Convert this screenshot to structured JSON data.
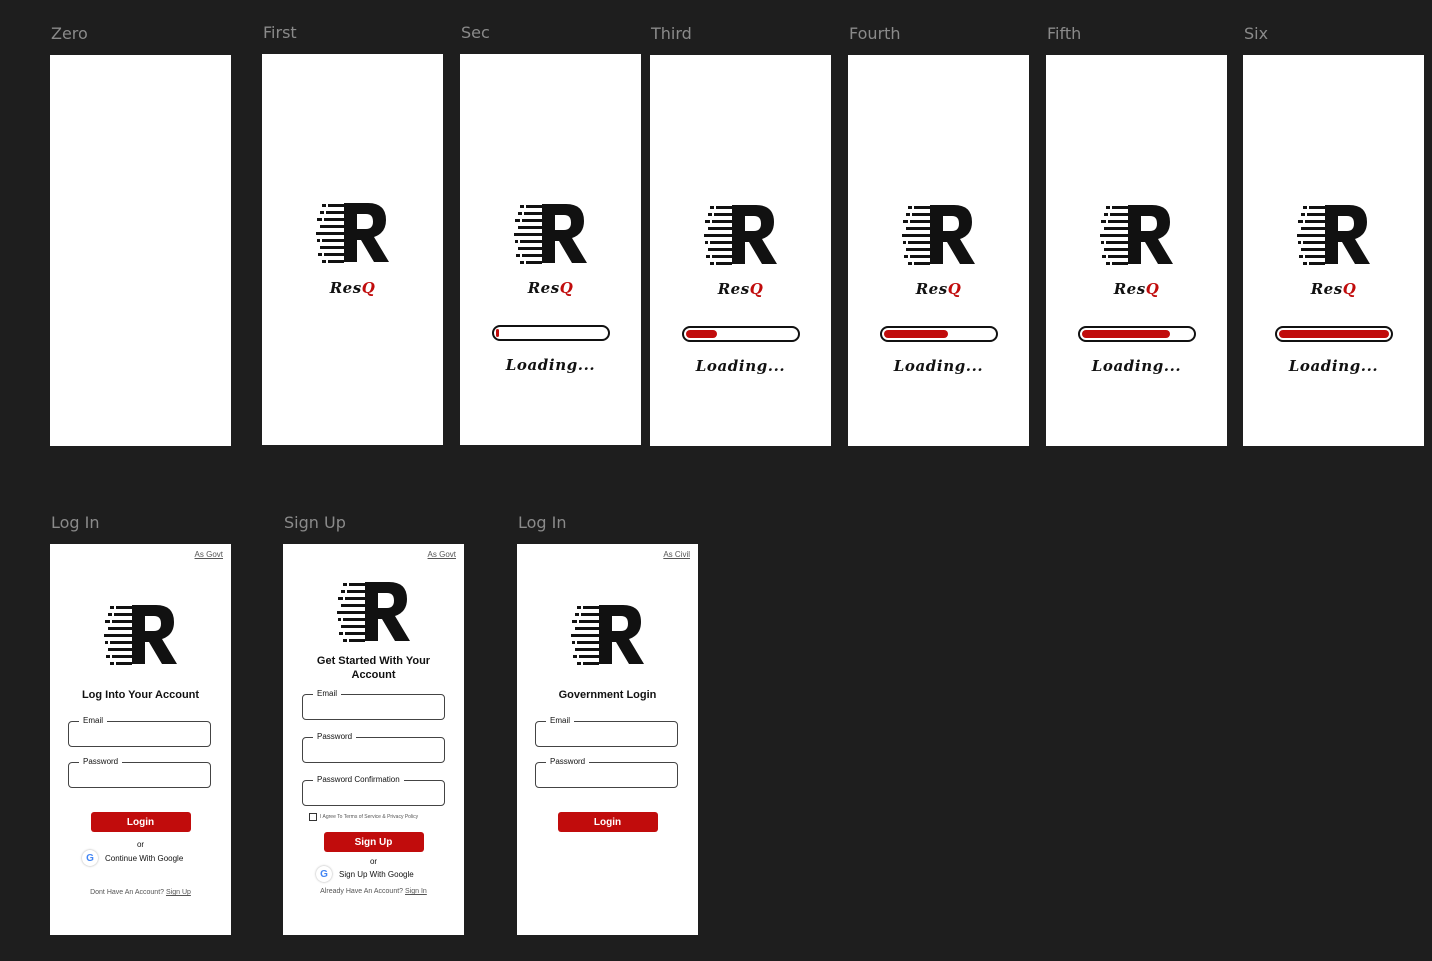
{
  "splash_frames": [
    {
      "label": "Zero"
    },
    {
      "label": "First",
      "brand": "Res",
      "brand_q": "Q"
    },
    {
      "label": "Sec",
      "brand": "Res",
      "brand_q": "Q",
      "loading": "Loading...",
      "progress": 0.03
    },
    {
      "label": "Third",
      "brand": "Res",
      "brand_q": "Q",
      "loading": "Loading...",
      "progress": 0.28
    },
    {
      "label": "Fourth",
      "brand": "Res",
      "brand_q": "Q",
      "loading": "Loading...",
      "progress": 0.58
    },
    {
      "label": "Fifth",
      "brand": "Res",
      "brand_q": "Q",
      "loading": "Loading...",
      "progress": 0.8
    },
    {
      "label": "Six",
      "brand": "Res",
      "brand_q": "Q",
      "loading": "Loading...",
      "progress": 1.0
    }
  ],
  "login": {
    "label": "Log In",
    "top_link": "As Govt",
    "heading": "Log Into Your Account",
    "email_label": "Email",
    "password_label": "Password",
    "login_button": "Login",
    "or": "or",
    "google_label": "Continue With Google",
    "bottom_text": "Dont Have An Account?",
    "bottom_link": "Sign Up"
  },
  "signup": {
    "label": "Sign Up",
    "top_link": "As Govt",
    "heading_line1": "Get Started With Your",
    "heading_line2": "Account",
    "email_label": "Email",
    "password_label": "Password",
    "confirm_label": "Password Confirmation",
    "terms": "I Agree To Terms of Service & Privacy Policy",
    "signup_button": "Sign Up",
    "or": "or",
    "google_label": "Sign Up With Google",
    "bottom_text": "Already Have An Account?",
    "bottom_link": "Sign In"
  },
  "gov_login": {
    "label": "Log In",
    "top_link": "As Civil",
    "heading": "Government Login",
    "email_label": "Email",
    "password_label": "Password",
    "login_button": "Login"
  },
  "colors": {
    "accent": "#c10c0c",
    "canvas": "#1e1e1e",
    "frame": "#ffffff"
  },
  "icons": {
    "logo": "resq-r-logo",
    "google": "google-g-icon"
  }
}
